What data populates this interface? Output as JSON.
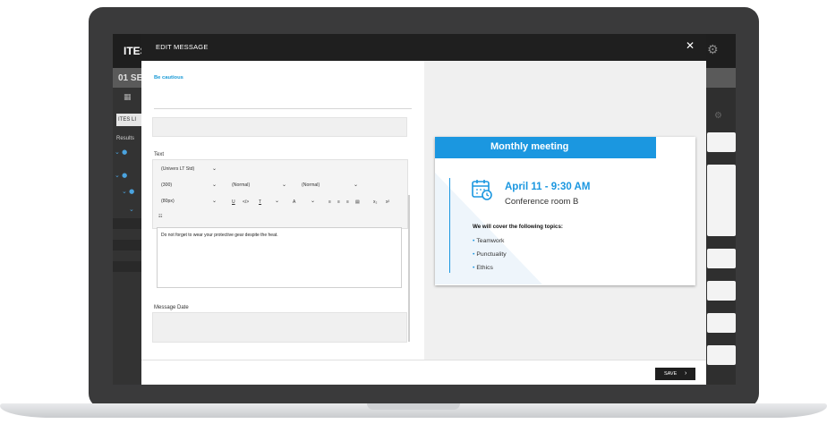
{
  "app": {
    "logo": "ITES",
    "row2_label": "01 SE",
    "chip": "ITES LI",
    "results": "Results"
  },
  "modal": {
    "title": "EDIT MESSAGE",
    "close_glyph": "✕"
  },
  "form": {
    "caution_link": "Be cautious",
    "text_label": "Text",
    "toolbar": {
      "font_family": "(Univers LT Std)",
      "font_weight": "(300)",
      "style_1": "(Normal)",
      "style_2": "(Normal)",
      "font_size": "(80px)",
      "underline": "U",
      "code": "</>",
      "text_tool": "T",
      "font_color": "A",
      "list_glyph": "☷"
    },
    "editor_text": "Do not forget to wear your protective gear despite the heat.",
    "date_label": "Message Date"
  },
  "footer": {
    "save_label": "SAVE",
    "save_chevron": "›"
  },
  "preview": {
    "title": "Monthly meeting",
    "date_time": "April 11 - 9:30 AM",
    "room": "Conference room B",
    "cover_heading": "We will cover the following topics:",
    "topics": [
      "Teamwork",
      "Punctuality",
      "Ethics"
    ],
    "accent_color": "#1b97e0"
  }
}
